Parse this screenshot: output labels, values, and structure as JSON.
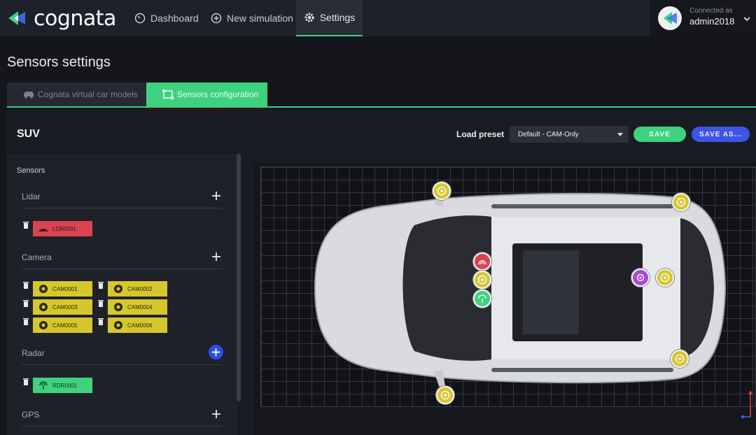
{
  "app": {
    "brand": "cognata"
  },
  "nav": {
    "dashboard": "Dashboard",
    "new_simulation": "New simulation",
    "settings": "Settings"
  },
  "user": {
    "connected_as": "Connected as",
    "name": "admin2018"
  },
  "page": {
    "title": "Sensors settings"
  },
  "tabs": [
    {
      "label": "Cognata virtual car models",
      "active": false
    },
    {
      "label": "Sensors configuration",
      "active": true
    }
  ],
  "vehicle": {
    "name": "SUV"
  },
  "preset": {
    "label": "Load preset",
    "selected": "Default - CAM-Only"
  },
  "actions": {
    "save": "SAVE",
    "save_as": "SAVE AS..."
  },
  "sidebar": {
    "title": "Sensors",
    "groups": [
      {
        "label": "Lidar",
        "sensors": [
          "LDR0001"
        ]
      },
      {
        "label": "Camera",
        "sensors": [
          "CAM0001",
          "CAM0002",
          "CAM0003",
          "CAM0004",
          "CAM0005",
          "CAM0006"
        ]
      },
      {
        "label": "Radar",
        "sensors": [
          "RDR0001"
        ]
      },
      {
        "label": "GPS",
        "sensors": []
      }
    ]
  },
  "colors": {
    "accent_green": "#3ed27e",
    "accent_blue": "#3d55e6",
    "lidar_red": "#d94450",
    "camera_yellow": "#d6c72c",
    "gps_purple": "#a64ad1",
    "background": "#14161c"
  },
  "icons": {
    "dashboard": "gauge-icon",
    "new_simulation": "plus-circle-icon",
    "settings": "gear-icon",
    "car_models": "car-icon",
    "sensors_config": "frame-icon",
    "lidar": "lidar-waves-icon",
    "camera": "aperture-icon",
    "radar": "antenna-icon",
    "delete": "trash-icon"
  }
}
